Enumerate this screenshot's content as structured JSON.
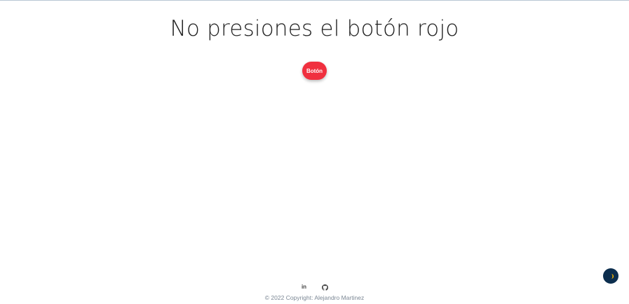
{
  "main": {
    "title": "No presiones el botón rojo",
    "button_label": "Botón"
  },
  "footer": {
    "social_links": [
      {
        "icon": "linkedin-icon",
        "label": "in"
      },
      {
        "icon": "github-icon"
      }
    ],
    "copyright": "© 2022 Copyright: Alejandro Martinez"
  },
  "theme_toggle": {
    "icon": "half-moon-icon"
  },
  "colors": {
    "button": "#f0303f",
    "toggle_background": "#0c2e4e",
    "toggle_icon": "#f5b400",
    "footer_text": "#7b8794"
  }
}
